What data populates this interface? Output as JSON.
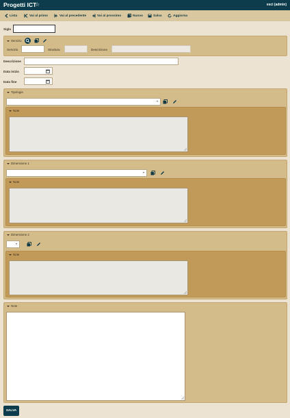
{
  "app": {
    "title": "Progetti ICT",
    "user": "esci (admin)"
  },
  "toolbar": {
    "list": "Lista",
    "first": "Vai al primo",
    "prev": "Vai al precedente",
    "next": "Vai al prossimo",
    "new": "Nuovo",
    "save": "Salva",
    "refresh": "Aggiorna"
  },
  "form": {
    "sigla_label": "Sigla",
    "servizio": {
      "legend": "Servizio",
      "servizio_label": "Servizio",
      "struttura_label": "Struttura",
      "descrizione_label": "Descrizione"
    },
    "descrizione_label": "Descrizione",
    "data_inizio_label": "Data inizio",
    "data_fine_label": "Data fine",
    "tipologia": {
      "legend": "Tipologia",
      "note_legend": "Note"
    },
    "dimensione1": {
      "legend": "Dimensione 1",
      "note_legend": "Note"
    },
    "dimensione2": {
      "legend": "Dimensione 2",
      "note_legend": "Note"
    },
    "note": {
      "legend": "Note"
    },
    "submit": "SALVA"
  },
  "colors": {
    "brand": "#0d3d4c",
    "toolbar": "#d8c79f",
    "panel": "#d3bb8a",
    "panel_dark": "#c19a5a"
  }
}
